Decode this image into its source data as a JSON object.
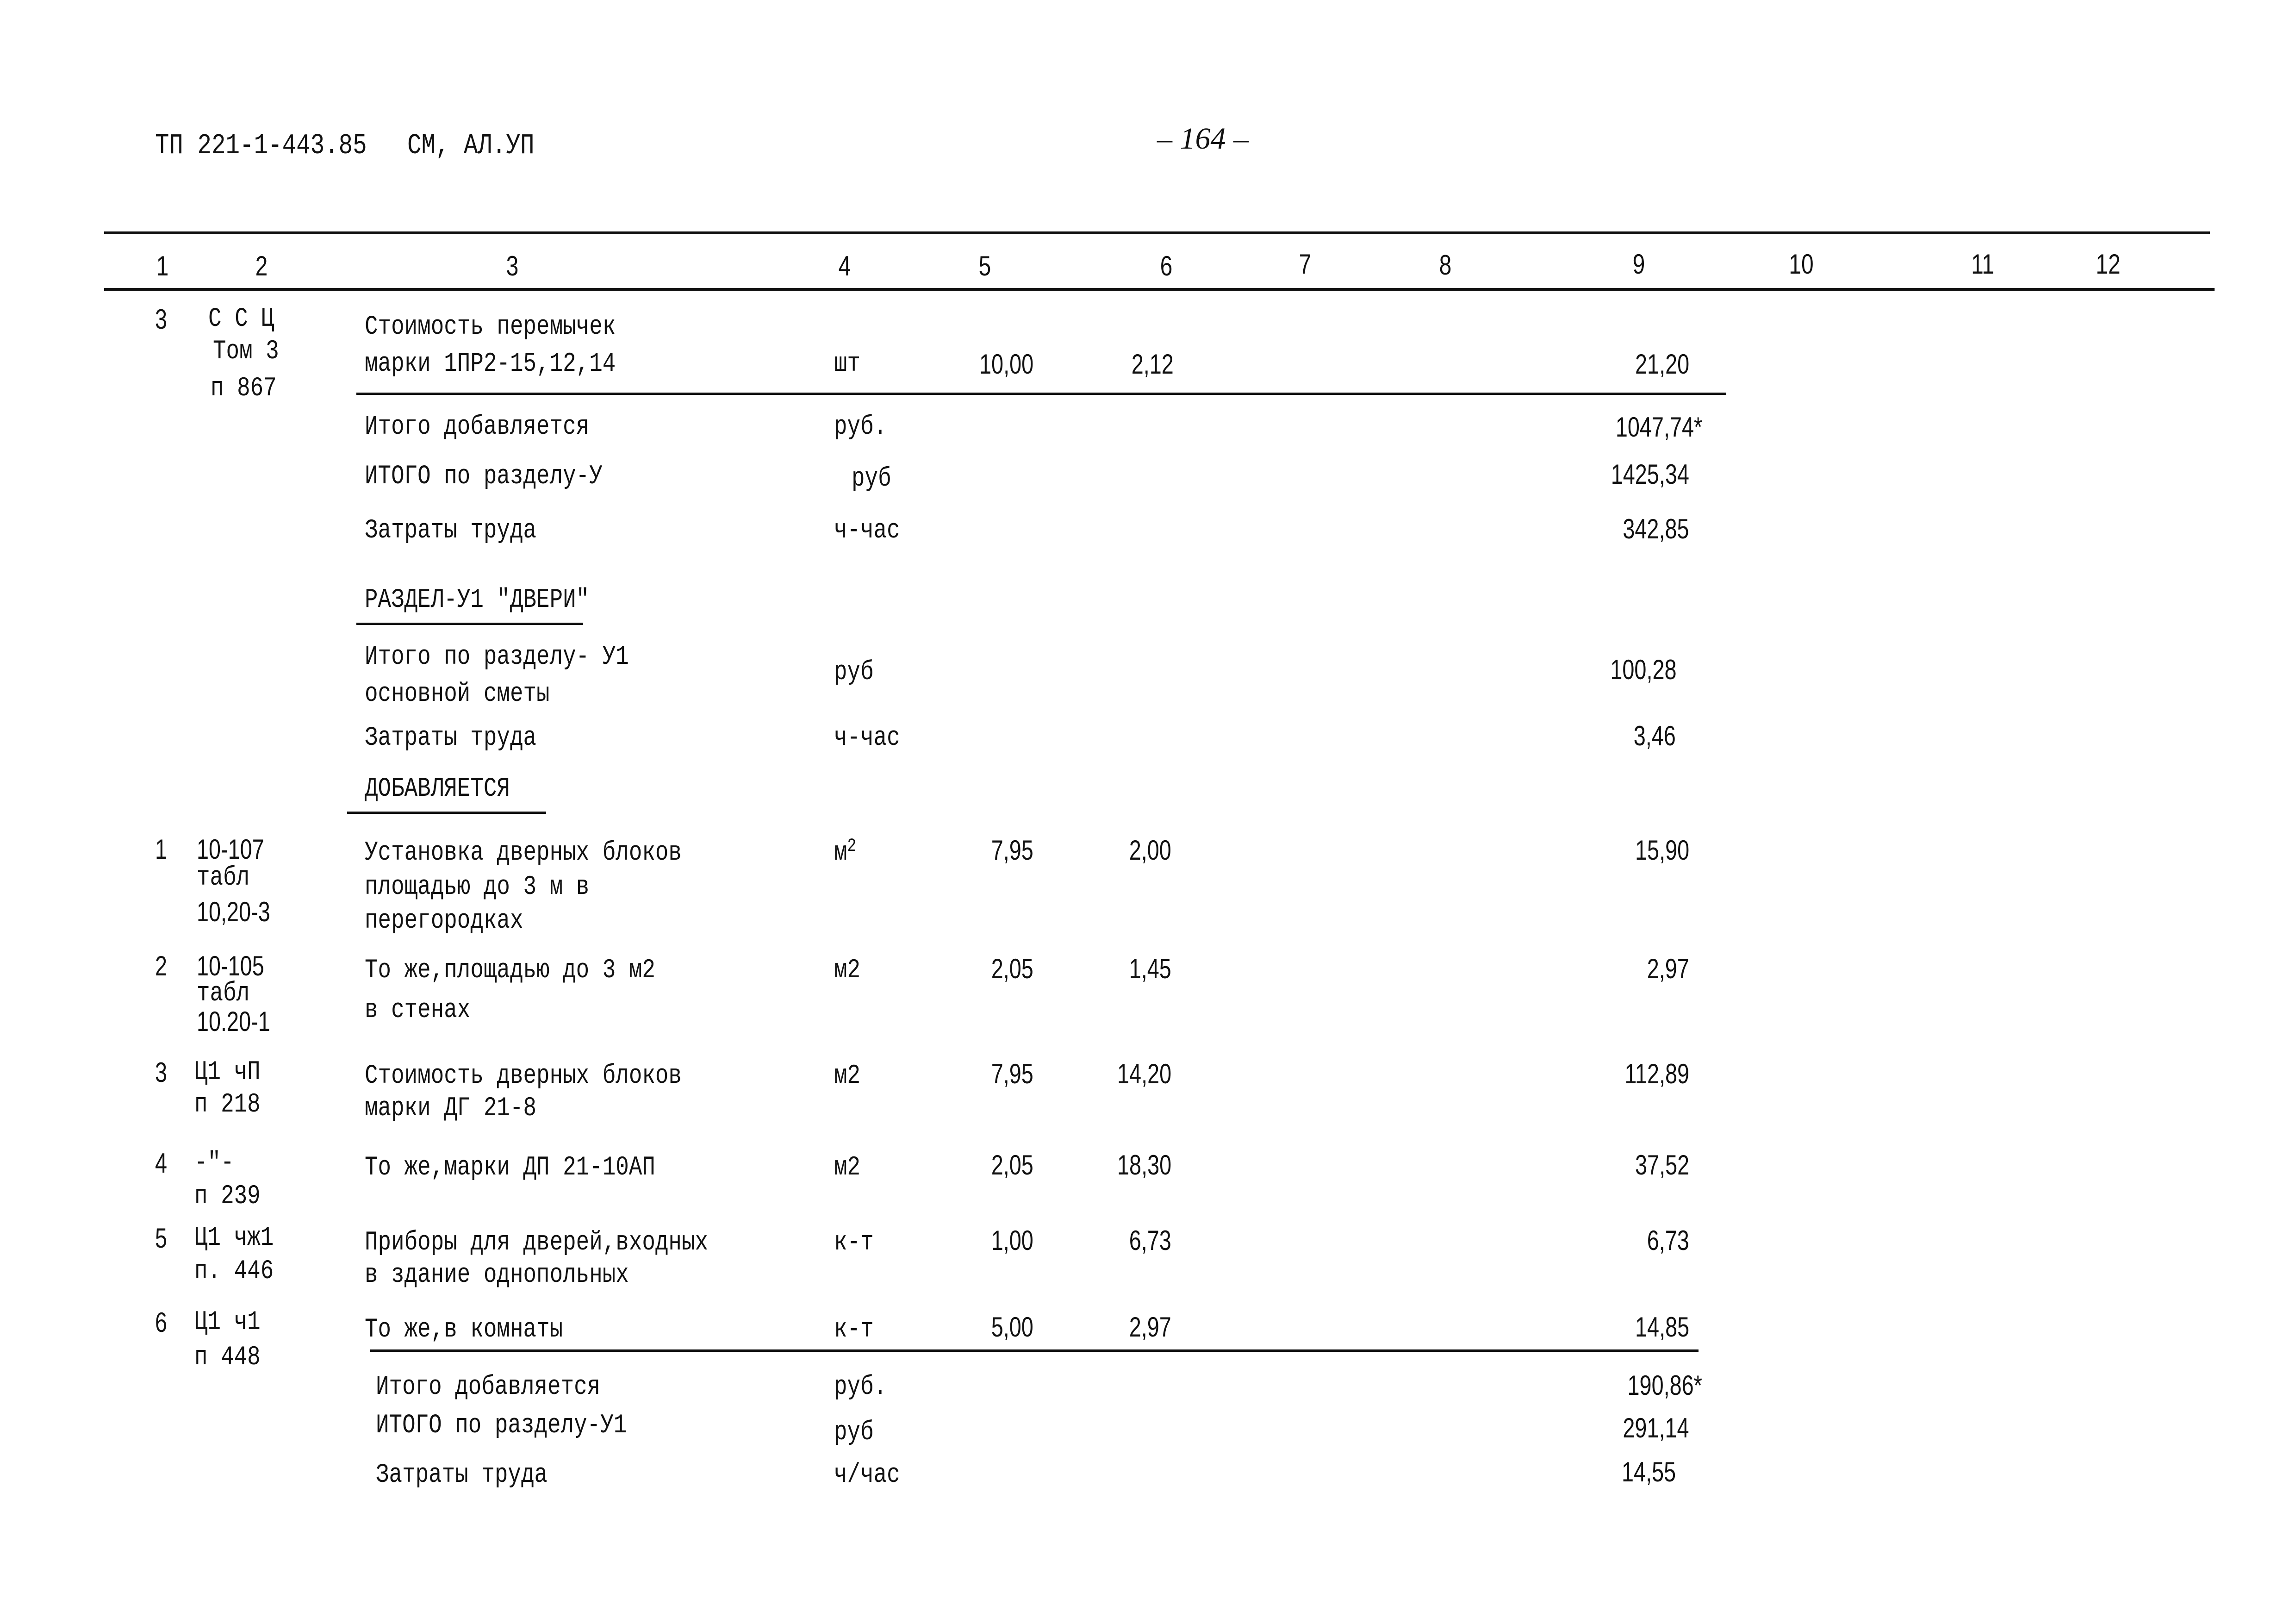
{
  "header": {
    "doc_code": "ТП 221-1-443.85",
    "doc_section": "СМ, АЛ.УП",
    "page_number": "– 164 –"
  },
  "columns": [
    "1",
    "2",
    "3",
    "4",
    "5",
    "6",
    "7",
    "8",
    "9",
    "10",
    "11",
    "12"
  ],
  "section5_tail": {
    "item": {
      "no": "3",
      "code": [
        "С С Ц",
        "Том 3",
        "п 867"
      ],
      "name": [
        "Стоимость перемычек",
        "марки 1ПР2-15,12,14"
      ],
      "unit": "шт",
      "qty": "10,00",
      "price": "2,12",
      "total": "21,20"
    },
    "totals": [
      {
        "label": "Итого добавляется",
        "unit": "руб.",
        "value": "1047,74*"
      },
      {
        "label": "ИТОГО по разделу-У",
        "unit": "руб",
        "value": "1425,34"
      },
      {
        "label": "Затраты труда",
        "unit": "ч-час",
        "value": "342,85"
      }
    ]
  },
  "section6": {
    "title": "РАЗДЕЛ-У1 \"ДВЕРИ\"",
    "base_total": {
      "label": [
        "Итого по разделу- У1",
        "основной сметы"
      ],
      "unit": "руб",
      "value": "100,28"
    },
    "base_labor": {
      "label": "Затраты труда",
      "unit": "ч-час",
      "value": "3,46"
    },
    "added_heading": "ДОБАВЛЯЕТСЯ",
    "items": [
      {
        "no": "1",
        "code": [
          "10-107",
          "табл",
          "10,20-3"
        ],
        "name": [
          "Установка дверных блоков",
          "площадью до 3 м в",
          "перегородках"
        ],
        "unit": "м",
        "unit_sup": "2",
        "qty": "7,95",
        "price": "2,00",
        "total": "15,90"
      },
      {
        "no": "2",
        "code": [
          "10-105",
          "табл",
          "10.20-1"
        ],
        "name": [
          "То же,площадью до 3 м2",
          "в стенах"
        ],
        "unit": "м2",
        "unit_sup": "",
        "qty": "2,05",
        "price": "1,45",
        "total": "2,97"
      },
      {
        "no": "3",
        "code": [
          "Ц1 чП",
          "п 218"
        ],
        "name": [
          "Стоимость дверных блоков",
          "марки ДГ 21-8"
        ],
        "unit": "м2",
        "unit_sup": "",
        "qty": "7,95",
        "price": "14,20",
        "total": "112,89"
      },
      {
        "no": "4",
        "code": [
          "-\"-",
          "п 239"
        ],
        "name": [
          "То же,марки ДП 21-10АП"
        ],
        "unit": "м2",
        "unit_sup": "",
        "qty": "2,05",
        "price": "18,30",
        "total": "37,52"
      },
      {
        "no": "5",
        "code": [
          "Ц1 чж1",
          "п. 446"
        ],
        "name": [
          "Приборы для дверей,входных",
          "в здание однопольных"
        ],
        "unit": "к-т",
        "unit_sup": "",
        "qty": "1,00",
        "price": "6,73",
        "total": "6,73"
      },
      {
        "no": "6",
        "code": [
          "Ц1 ч1",
          "п 448"
        ],
        "name": [
          "То же,в комнаты"
        ],
        "unit": "к-т",
        "unit_sup": "",
        "qty": "5,00",
        "price": "2,97",
        "total": "14,85"
      }
    ],
    "totals": [
      {
        "label": "Итого  добавляется",
        "unit": "руб.",
        "value": "190,86*"
      },
      {
        "label": "ИТОГО по разделу-У1",
        "unit": "руб",
        "value": "291,14"
      },
      {
        "label": "Затраты труда",
        "unit": "ч/час",
        "value": "14,55"
      }
    ]
  }
}
